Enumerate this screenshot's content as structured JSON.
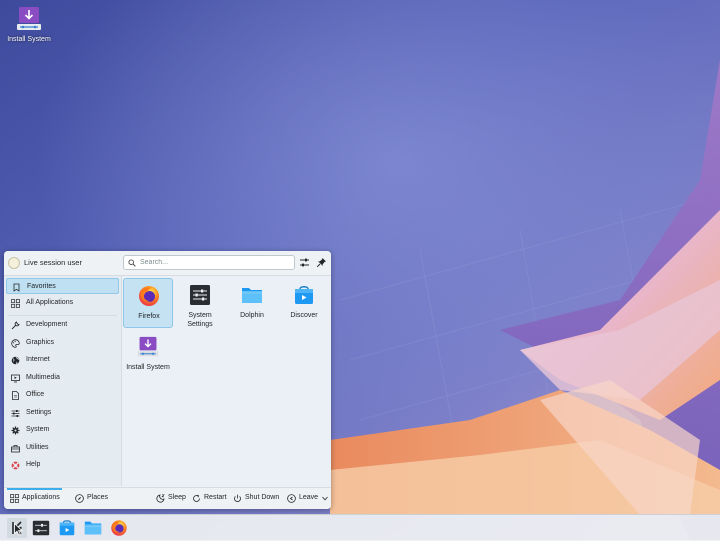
{
  "desktop": {
    "icons": [
      {
        "label": "Install System",
        "icon": "install-system-icon"
      }
    ]
  },
  "launcher": {
    "user": {
      "name": "Live session user",
      "icon": "avatar"
    },
    "search": {
      "placeholder": "Search...",
      "value": ""
    },
    "header_icons": [
      "filter-icon",
      "pin-icon"
    ],
    "sidebar": {
      "items": [
        {
          "label": "Favorites",
          "icon": "bookmark-icon",
          "selected": true
        },
        {
          "label": "All Applications",
          "icon": "grid-icon"
        },
        {
          "label": "Development",
          "icon": "wrench-icon"
        },
        {
          "label": "Graphics",
          "icon": "palette-icon"
        },
        {
          "label": "Internet",
          "icon": "globe-icon"
        },
        {
          "label": "Multimedia",
          "icon": "monitor-icon"
        },
        {
          "label": "Office",
          "icon": "document-icon"
        },
        {
          "label": "Settings",
          "icon": "sliders-icon"
        },
        {
          "label": "System",
          "icon": "gear-icon"
        },
        {
          "label": "Utilities",
          "icon": "toolbox-icon"
        },
        {
          "label": "Help",
          "icon": "lifebuoy-icon"
        }
      ]
    },
    "apps": [
      {
        "label": "Firefox",
        "icon": "firefox-icon",
        "selected": true
      },
      {
        "label": "System Settings",
        "icon": "system-settings-icon"
      },
      {
        "label": "Dolphin",
        "icon": "folder-icon"
      },
      {
        "label": "Discover",
        "icon": "discover-icon"
      },
      {
        "label": "Install System",
        "icon": "install-system-icon"
      }
    ],
    "footer": {
      "applications_label": "Applications",
      "places_label": "Places",
      "sleep_label": "Sleep",
      "restart_label": "Restart",
      "shutdown_label": "Shut Down",
      "leave_label": "Leave"
    }
  },
  "taskbar": {
    "items": [
      "application-launcher-icon",
      "system-settings-icon",
      "discover-icon",
      "folder-icon",
      "firefox-icon"
    ]
  },
  "colors": {
    "accent": "#3daee9",
    "selection": "#c5e2f3",
    "panel": "#eaf0f5"
  }
}
